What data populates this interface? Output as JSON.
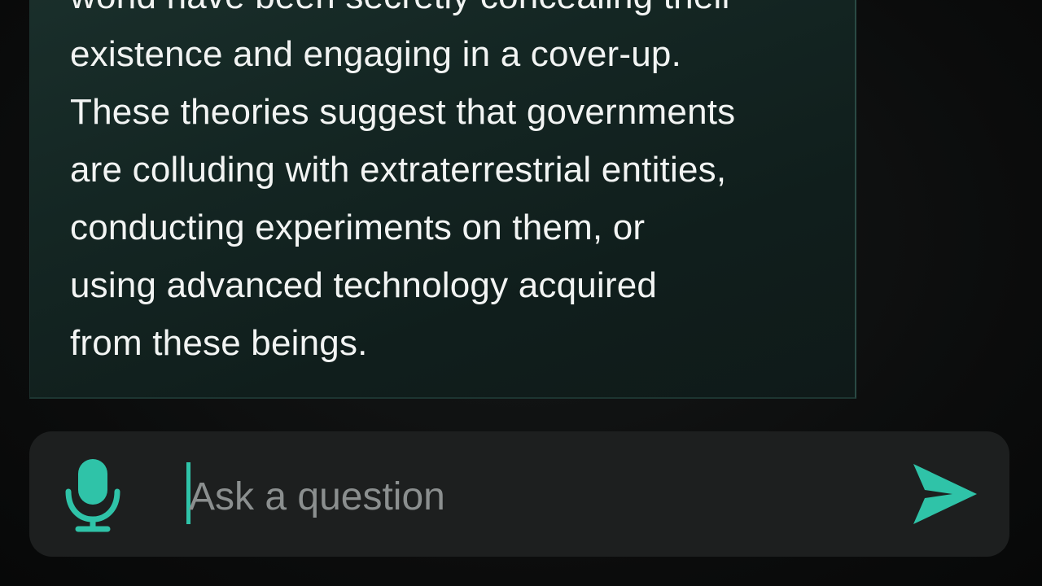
{
  "conversation": {
    "response_lines": [
      "world have been secretly concealing their",
      "existence and engaging in a cover-up.",
      "These theories suggest that governments",
      "are colluding with extraterrestrial entities,",
      "conducting experiments on them, or",
      "using advanced technology acquired",
      "from these beings."
    ]
  },
  "composer": {
    "placeholder": "Ask a question",
    "value": "",
    "mic_icon": "microphone-icon",
    "send_icon": "send-arrow-icon"
  },
  "colors": {
    "accent": "#2fc3a8",
    "bubble_background": "#142623",
    "input_background": "#1d1f1f",
    "text": "#f2f4f3",
    "placeholder": "#8b8f8f"
  }
}
